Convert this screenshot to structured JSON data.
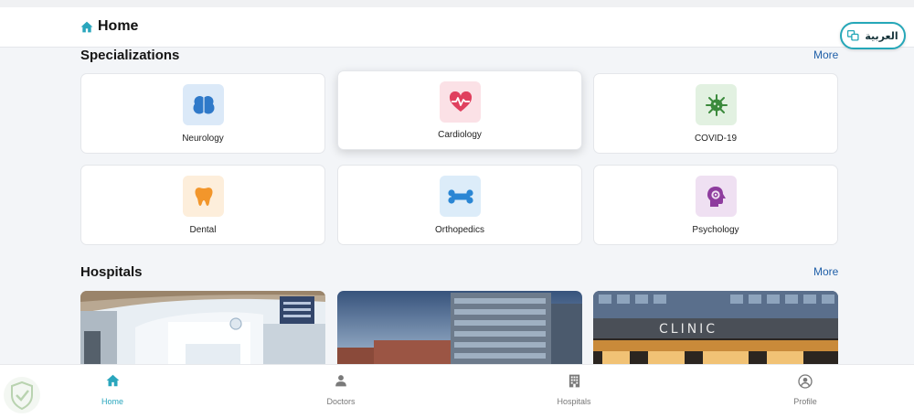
{
  "header": {
    "title": "Home",
    "home_icon": "home-icon",
    "language_button": "العربية",
    "language_icon": "translate-icon"
  },
  "specializations": {
    "title": "Specializations",
    "more": "More",
    "items": [
      {
        "label": "Neurology",
        "icon": "brain-icon",
        "bg": "#dbe9f8",
        "color": "#2f79c9"
      },
      {
        "label": "Cardiology",
        "icon": "heart-pulse-icon",
        "bg": "#fbe1e6",
        "color": "#e0405e"
      },
      {
        "label": "COVID-19",
        "icon": "virus-icon",
        "bg": "#e2f1e1",
        "color": "#3b8a3c"
      },
      {
        "label": "Dental",
        "icon": "tooth-icon",
        "bg": "#fdeedb",
        "color": "#f2962b"
      },
      {
        "label": "Orthopedics",
        "icon": "bone-icon",
        "bg": "#dcecf9",
        "color": "#2a86d4"
      },
      {
        "label": "Psychology",
        "icon": "head-gear-icon",
        "bg": "#efe0f2",
        "color": "#8e3c9e"
      }
    ]
  },
  "hospitals": {
    "title": "Hospitals",
    "more": "More",
    "sign_text": "CLINIC"
  },
  "bottom_nav": [
    {
      "label": "Home",
      "icon": "home-icon",
      "active": true
    },
    {
      "label": "Doctors",
      "icon": "person-icon",
      "active": false
    },
    {
      "label": "Hospitals",
      "icon": "building-icon",
      "active": false
    },
    {
      "label": "Profile",
      "icon": "account-circle-icon",
      "active": false
    }
  ],
  "colors": {
    "accent": "#2aa6bd",
    "link": "#1f5fa8"
  }
}
